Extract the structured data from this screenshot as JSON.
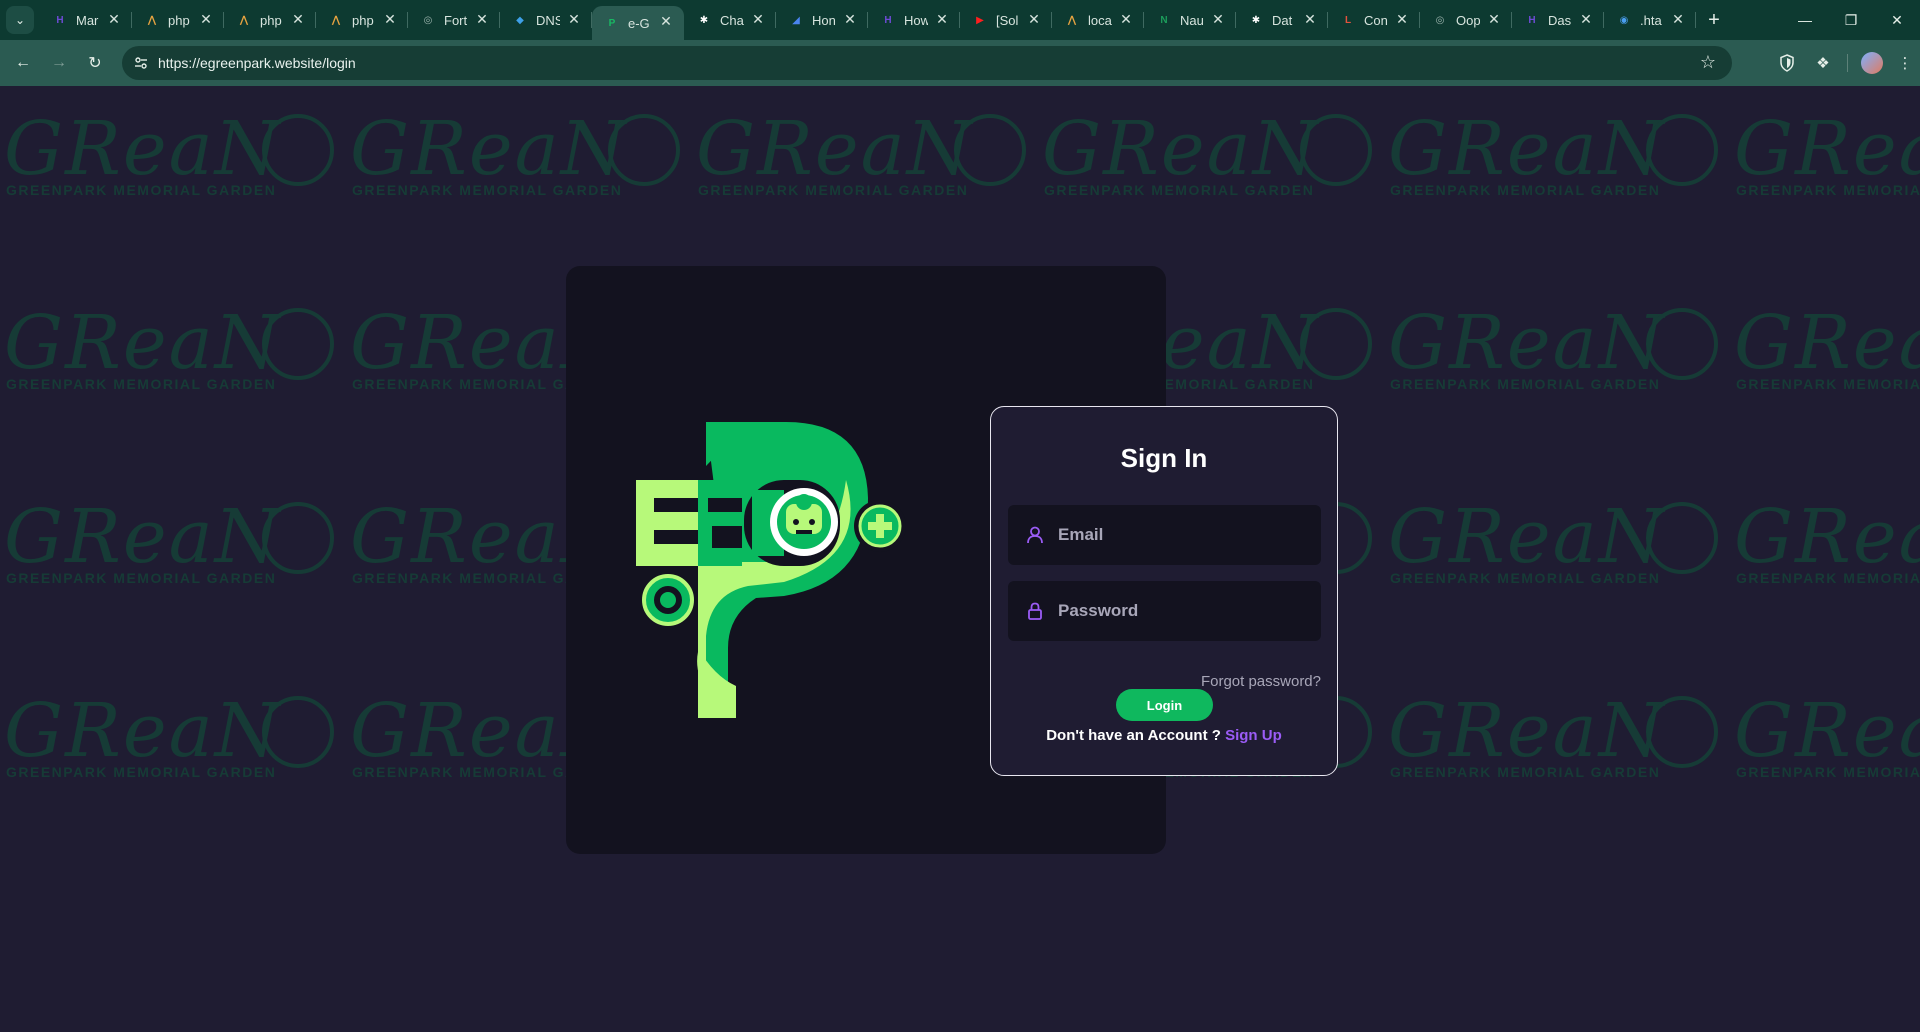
{
  "browser": {
    "tabs": [
      {
        "label": "Mar",
        "favicon": "H",
        "color": "#6d4bd6",
        "active": false
      },
      {
        "label": "php",
        "favicon": "⋀",
        "color": "#e7a341",
        "active": false
      },
      {
        "label": "php",
        "favicon": "⋀",
        "color": "#e7a341",
        "active": false
      },
      {
        "label": "php",
        "favicon": "⋀",
        "color": "#e7a341",
        "active": false
      },
      {
        "label": "Fort",
        "favicon": "◎",
        "color": "#9fb6b0",
        "active": false
      },
      {
        "label": "DNS",
        "favicon": "◆",
        "color": "#3ea0e8",
        "active": false
      },
      {
        "label": "e-G",
        "favicon": "P",
        "color": "#19b863",
        "active": true
      },
      {
        "label": "Cha",
        "favicon": "✱",
        "color": "#ffffff",
        "active": false
      },
      {
        "label": "Hon",
        "favicon": "◢",
        "color": "#4a84ef",
        "active": false
      },
      {
        "label": "How",
        "favicon": "H",
        "color": "#6d4bd6",
        "active": false
      },
      {
        "label": "[Sol",
        "favicon": "▶",
        "color": "#ff1e1e",
        "active": false
      },
      {
        "label": "loca",
        "favicon": "⋀",
        "color": "#e7a341",
        "active": false
      },
      {
        "label": "Nau",
        "favicon": "N",
        "color": "#1c9d5b",
        "active": false
      },
      {
        "label": "Dat",
        "favicon": "✱",
        "color": "#ffffff",
        "active": false
      },
      {
        "label": "Con",
        "favicon": "L",
        "color": "#e2533e",
        "active": false
      },
      {
        "label": "Oop",
        "favicon": "◎",
        "color": "#9fb6b0",
        "active": false
      },
      {
        "label": "Das",
        "favicon": "H",
        "color": "#6d4bd6",
        "active": false
      },
      {
        "label": ".hta",
        "favicon": "◉",
        "color": "#4a9ef0",
        "active": false
      }
    ],
    "url": "https://egreenpark.website/login",
    "icons": [
      "back-icon",
      "forward-icon",
      "reload-icon",
      "site-info-icon",
      "star-icon",
      "shield-icon",
      "extensions-icon",
      "menu-icon"
    ]
  },
  "watermark": {
    "script": "GReaN",
    "tagline": "GREENPARK MEMORIAL GARDEN"
  },
  "logo": {
    "letters": "EG",
    "colors": {
      "dark_green": "#09b95f",
      "light_green": "#b7f97a"
    }
  },
  "signin": {
    "title": "Sign In",
    "email_placeholder": "Email",
    "password_placeholder": "Password",
    "forgot": "Forgot password?",
    "login": "Login",
    "no_account": "Don't have an Account ?",
    "signup": "Sign Up",
    "accent": "#9b5cf6",
    "button_color": "#0fb85e"
  }
}
